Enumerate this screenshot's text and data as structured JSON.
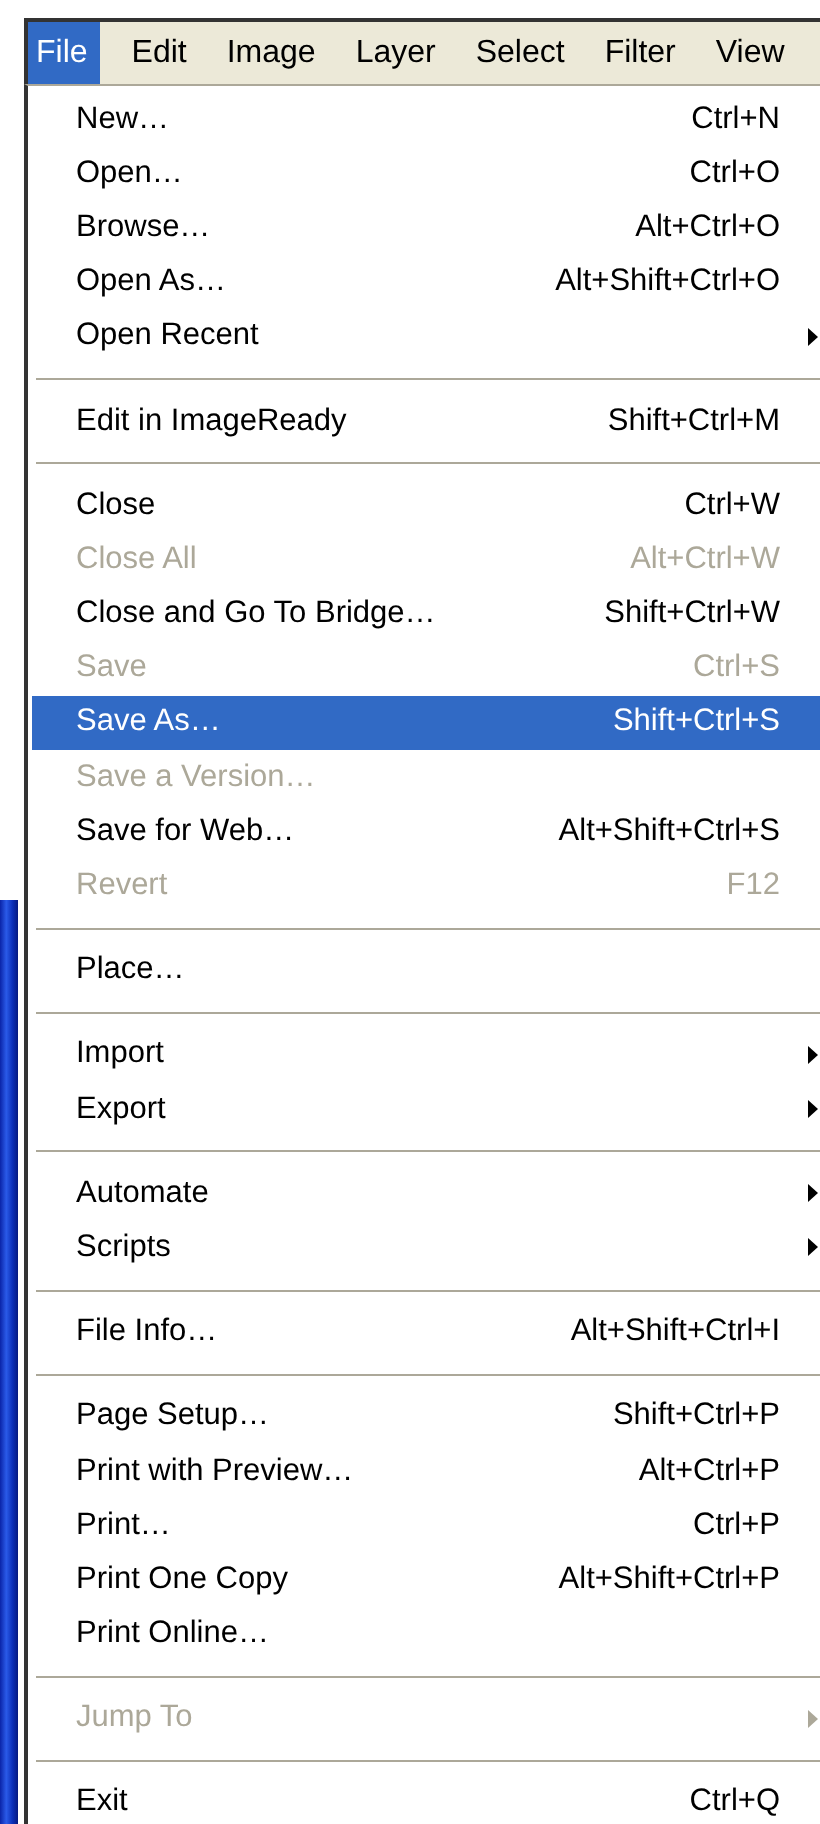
{
  "menubar": [
    {
      "label": "File",
      "selected": true
    },
    {
      "label": "Edit",
      "selected": false
    },
    {
      "label": "Image",
      "selected": false
    },
    {
      "label": "Layer",
      "selected": false
    },
    {
      "label": "Select",
      "selected": false
    },
    {
      "label": "Filter",
      "selected": false
    },
    {
      "label": "View",
      "selected": false
    }
  ],
  "menu": {
    "groups": [
      {
        "items": [
          {
            "kind": "command",
            "label": "New…",
            "shortcut": "Ctrl+N",
            "disabled": false,
            "selected": false
          },
          {
            "kind": "command",
            "label": "Open…",
            "shortcut": "Ctrl+O",
            "disabled": false,
            "selected": false
          },
          {
            "kind": "command",
            "label": "Browse…",
            "shortcut": "Alt+Ctrl+O",
            "disabled": false,
            "selected": false
          },
          {
            "kind": "command",
            "label": "Open As…",
            "shortcut": "Alt+Shift+Ctrl+O",
            "disabled": false,
            "selected": false
          },
          {
            "kind": "submenu",
            "label": "Open Recent",
            "disabled": false,
            "selected": false
          }
        ]
      },
      {
        "items": [
          {
            "kind": "command",
            "label": "Edit in ImageReady",
            "shortcut": "Shift+Ctrl+M",
            "disabled": false,
            "selected": false
          }
        ]
      },
      {
        "items": [
          {
            "kind": "command",
            "label": "Close",
            "shortcut": "Ctrl+W",
            "disabled": false,
            "selected": false
          },
          {
            "kind": "command",
            "label": "Close All",
            "shortcut": "Alt+Ctrl+W",
            "disabled": true,
            "selected": false
          },
          {
            "kind": "command",
            "label": "Close and Go To Bridge…",
            "shortcut": "Shift+Ctrl+W",
            "disabled": false,
            "selected": false
          },
          {
            "kind": "command",
            "label": "Save",
            "shortcut": "Ctrl+S",
            "disabled": true,
            "selected": false
          },
          {
            "kind": "command",
            "label": "Save As…",
            "shortcut": "Shift+Ctrl+S",
            "disabled": false,
            "selected": true
          },
          {
            "kind": "command",
            "label": "Save a Version…",
            "disabled": true,
            "selected": false
          },
          {
            "kind": "command",
            "label": "Save for Web…",
            "shortcut": "Alt+Shift+Ctrl+S",
            "disabled": false,
            "selected": false
          },
          {
            "kind": "command",
            "label": "Revert",
            "shortcut": "F12",
            "disabled": true,
            "selected": false
          }
        ]
      },
      {
        "items": [
          {
            "kind": "command",
            "label": "Place…",
            "disabled": false,
            "selected": false
          }
        ]
      },
      {
        "items": [
          {
            "kind": "submenu",
            "label": "Import",
            "disabled": false,
            "selected": false
          },
          {
            "kind": "submenu",
            "label": "Export",
            "disabled": false,
            "selected": false
          }
        ]
      },
      {
        "items": [
          {
            "kind": "submenu",
            "label": "Automate",
            "disabled": false,
            "selected": false
          },
          {
            "kind": "submenu",
            "label": "Scripts",
            "disabled": false,
            "selected": false
          }
        ]
      },
      {
        "items": [
          {
            "kind": "command",
            "label": "File Info…",
            "shortcut": "Alt+Shift+Ctrl+I",
            "disabled": false,
            "selected": false
          }
        ]
      },
      {
        "items": [
          {
            "kind": "command",
            "label": "Page Setup…",
            "shortcut": "Shift+Ctrl+P",
            "disabled": false,
            "selected": false
          },
          {
            "kind": "command",
            "label": "Print with Preview…",
            "shortcut": "Alt+Ctrl+P",
            "disabled": false,
            "selected": false
          },
          {
            "kind": "command",
            "label": "Print…",
            "shortcut": "Ctrl+P",
            "disabled": false,
            "selected": false
          },
          {
            "kind": "command",
            "label": "Print One Copy",
            "shortcut": "Alt+Shift+Ctrl+P",
            "disabled": false,
            "selected": false
          },
          {
            "kind": "command",
            "label": "Print Online…",
            "disabled": false,
            "selected": false
          }
        ]
      },
      {
        "items": [
          {
            "kind": "submenu",
            "label": "Jump To",
            "disabled": true,
            "selected": false
          }
        ]
      },
      {
        "items": [
          {
            "kind": "command",
            "label": "Exit",
            "shortcut": "Ctrl+Q",
            "disabled": false,
            "selected": false
          }
        ]
      }
    ]
  }
}
